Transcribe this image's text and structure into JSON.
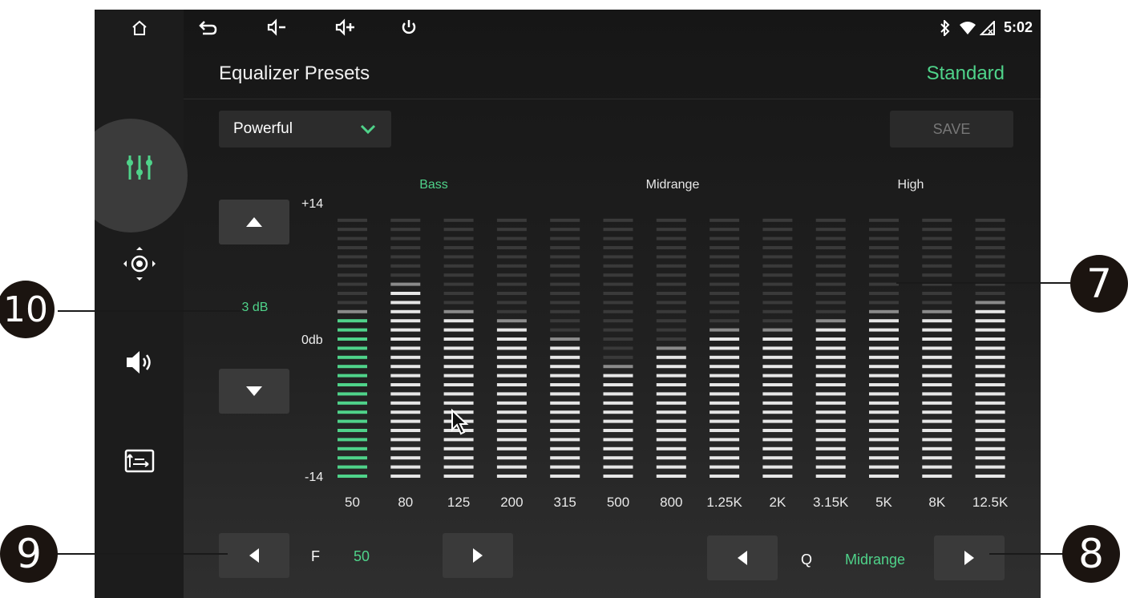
{
  "status_bar": {
    "icons": [
      "home-icon",
      "back-icon",
      "volume-down-icon",
      "volume-up-icon",
      "power-icon",
      "bluetooth-icon",
      "wifi-icon",
      "signal-icon"
    ],
    "time": "5:02"
  },
  "sidebar": {
    "items": [
      {
        "icon": "equalizer-icon",
        "active": true
      },
      {
        "icon": "balance-fader-icon",
        "active": false
      },
      {
        "icon": "speaker-sound-icon",
        "active": false
      },
      {
        "icon": "sound-field-icon",
        "active": false
      }
    ]
  },
  "header": {
    "title": "Equalizer Presets",
    "preset": "Standard"
  },
  "preset_dropdown": {
    "selected": "Powerful"
  },
  "save_label": "SAVE",
  "gain": {
    "value_label": "3 dB",
    "max_label": "+14",
    "zero_label": "0db",
    "min_label": "-14"
  },
  "groups": {
    "bass": "Bass",
    "midrange": "Midrange",
    "high": "High"
  },
  "bands": [
    {
      "freq": "50",
      "level": 18,
      "selected": true
    },
    {
      "freq": "80",
      "level": 21,
      "selected": false
    },
    {
      "freq": "125",
      "level": 18,
      "selected": false
    },
    {
      "freq": "200",
      "level": 17,
      "selected": false
    },
    {
      "freq": "315",
      "level": 15,
      "selected": false
    },
    {
      "freq": "500",
      "level": 12,
      "selected": false
    },
    {
      "freq": "800",
      "level": 14,
      "selected": false
    },
    {
      "freq": "1.25K",
      "level": 16,
      "selected": false
    },
    {
      "freq": "2K",
      "level": 16,
      "selected": false
    },
    {
      "freq": "3.15K",
      "level": 17,
      "selected": false
    },
    {
      "freq": "5K",
      "level": 18,
      "selected": false
    },
    {
      "freq": "8K",
      "level": 18,
      "selected": false
    },
    {
      "freq": "12.5K",
      "level": 19,
      "selected": false
    }
  ],
  "frequency_control": {
    "label": "F",
    "value": "50"
  },
  "q_control": {
    "label": "Q",
    "value": "Midrange"
  },
  "callouts": {
    "c7": "7",
    "c8": "8",
    "c9": "9",
    "c10": "10"
  },
  "colors": {
    "accent": "#4fd38a",
    "background": "#1c1c1c",
    "button": "#3a3a3a"
  }
}
